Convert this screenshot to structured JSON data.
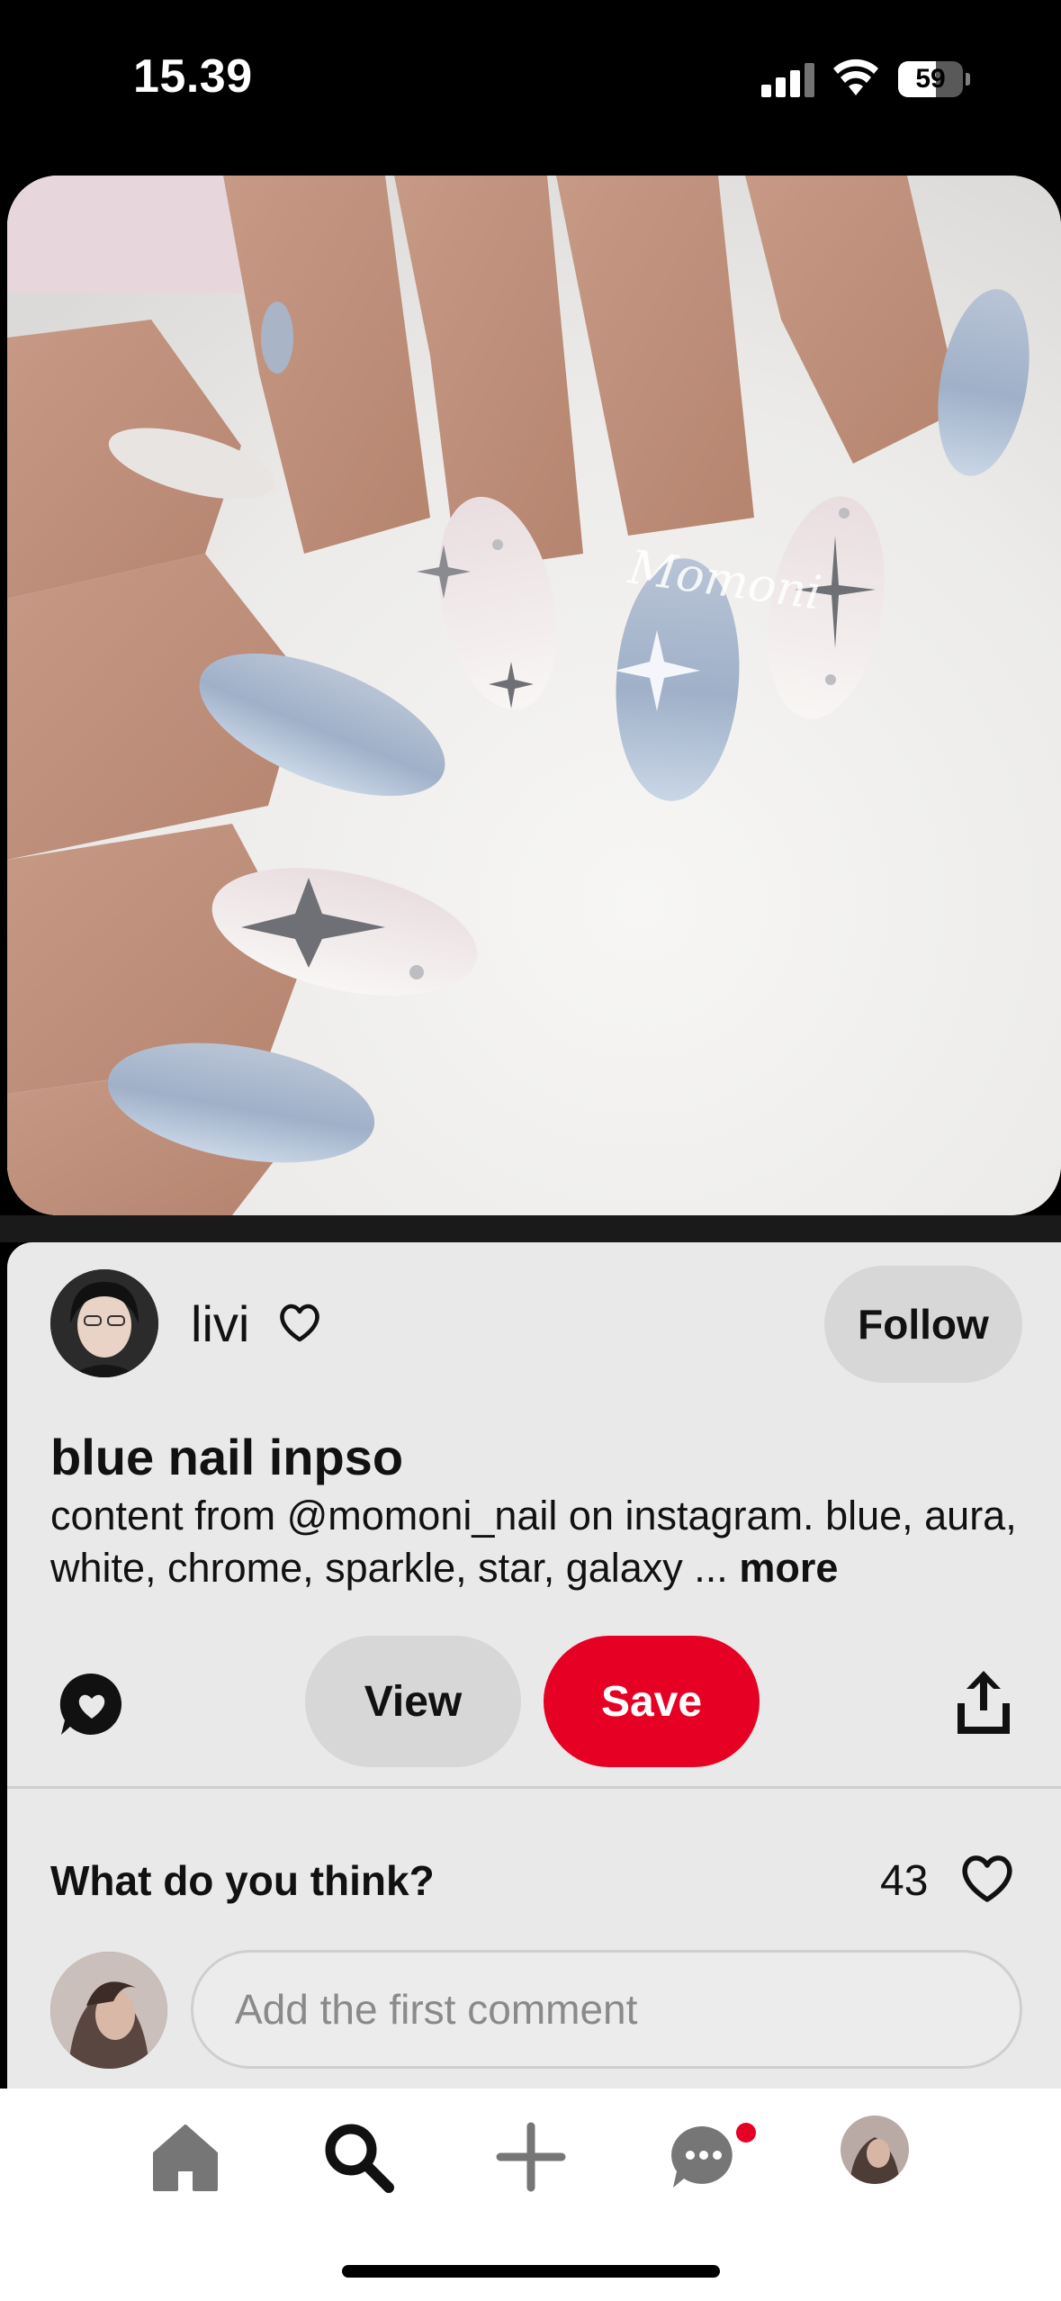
{
  "status_bar": {
    "time": "15.39",
    "battery_level": "59"
  },
  "pin": {
    "image_alt": "Almond-shaped blue chrome and white aura nails with silver star designs",
    "watermark": "Momoni",
    "author": {
      "name": "livi"
    },
    "follow_label": "Follow",
    "title": "blue nail inpso",
    "description": "content from @momoni_nail on instagram. blue, aura, white, chrome, sparkle, star, galaxy ...",
    "more_label": "more",
    "view_label": "View",
    "save_label": "Save"
  },
  "comments": {
    "prompt": "What do you think?",
    "like_count": "43",
    "input_placeholder": "Add the first comment"
  },
  "bottom_nav": {
    "items": [
      {
        "name": "home",
        "icon": "home-icon"
      },
      {
        "name": "search",
        "icon": "search-icon",
        "active": true
      },
      {
        "name": "create",
        "icon": "plus-icon"
      },
      {
        "name": "messages",
        "icon": "chat-icon",
        "badge": true
      },
      {
        "name": "profile",
        "icon": "avatar"
      }
    ]
  },
  "colors": {
    "save_red": "#e60023",
    "card_bg": "#e9e9e9",
    "pill_gray": "#d7d7d7"
  }
}
